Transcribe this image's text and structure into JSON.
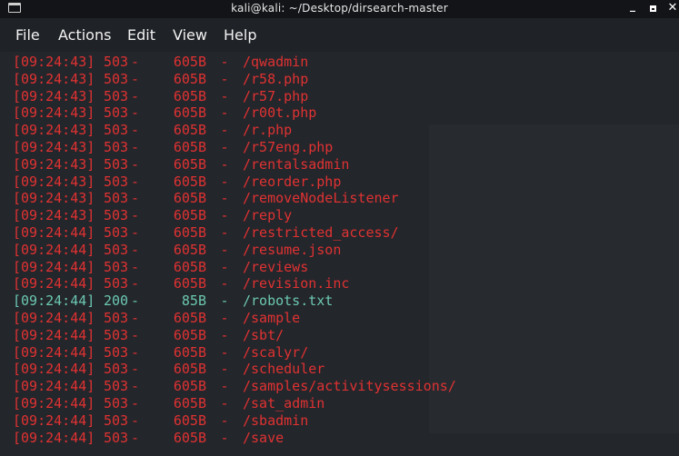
{
  "window": {
    "title": "kali@kali: ~/Desktop/dirsearch-master",
    "minimize_glyph": "_",
    "close_glyph": "✕"
  },
  "menu": {
    "file": "File",
    "actions": "Actions",
    "edit": "Edit",
    "view": "View",
    "help": "Help"
  },
  "colors": {
    "error_line": "#e03232",
    "success_line": "#6cc7b1",
    "background": "#23262b"
  },
  "log": [
    {
      "time": "[09:24:43]",
      "status": "503",
      "size": "605B",
      "path": "/qwadmin"
    },
    {
      "time": "[09:24:43]",
      "status": "503",
      "size": "605B",
      "path": "/r58.php"
    },
    {
      "time": "[09:24:43]",
      "status": "503",
      "size": "605B",
      "path": "/r57.php"
    },
    {
      "time": "[09:24:43]",
      "status": "503",
      "size": "605B",
      "path": "/r00t.php"
    },
    {
      "time": "[09:24:43]",
      "status": "503",
      "size": "605B",
      "path": "/r.php"
    },
    {
      "time": "[09:24:43]",
      "status": "503",
      "size": "605B",
      "path": "/r57eng.php"
    },
    {
      "time": "[09:24:43]",
      "status": "503",
      "size": "605B",
      "path": "/rentalsadmin"
    },
    {
      "time": "[09:24:43]",
      "status": "503",
      "size": "605B",
      "path": "/reorder.php"
    },
    {
      "time": "[09:24:43]",
      "status": "503",
      "size": "605B",
      "path": "/removeNodeListener"
    },
    {
      "time": "[09:24:43]",
      "status": "503",
      "size": "605B",
      "path": "/reply"
    },
    {
      "time": "[09:24:44]",
      "status": "503",
      "size": "605B",
      "path": "/restricted_access/"
    },
    {
      "time": "[09:24:44]",
      "status": "503",
      "size": "605B",
      "path": "/resume.json"
    },
    {
      "time": "[09:24:44]",
      "status": "503",
      "size": "605B",
      "path": "/reviews"
    },
    {
      "time": "[09:24:44]",
      "status": "503",
      "size": "605B",
      "path": "/revision.inc"
    },
    {
      "time": "[09:24:44]",
      "status": "200",
      "size": "85B",
      "path": "/robots.txt"
    },
    {
      "time": "[09:24:44]",
      "status": "503",
      "size": "605B",
      "path": "/sample"
    },
    {
      "time": "[09:24:44]",
      "status": "503",
      "size": "605B",
      "path": "/sbt/"
    },
    {
      "time": "[09:24:44]",
      "status": "503",
      "size": "605B",
      "path": "/scalyr/"
    },
    {
      "time": "[09:24:44]",
      "status": "503",
      "size": "605B",
      "path": "/scheduler"
    },
    {
      "time": "[09:24:44]",
      "status": "503",
      "size": "605B",
      "path": "/samples/activitysessions/"
    },
    {
      "time": "[09:24:44]",
      "status": "503",
      "size": "605B",
      "path": "/sat_admin"
    },
    {
      "time": "[09:24:44]",
      "status": "503",
      "size": "605B",
      "path": "/sbadmin"
    },
    {
      "time": "[09:24:44]",
      "status": "503",
      "size": "605B",
      "path": "/save"
    }
  ]
}
